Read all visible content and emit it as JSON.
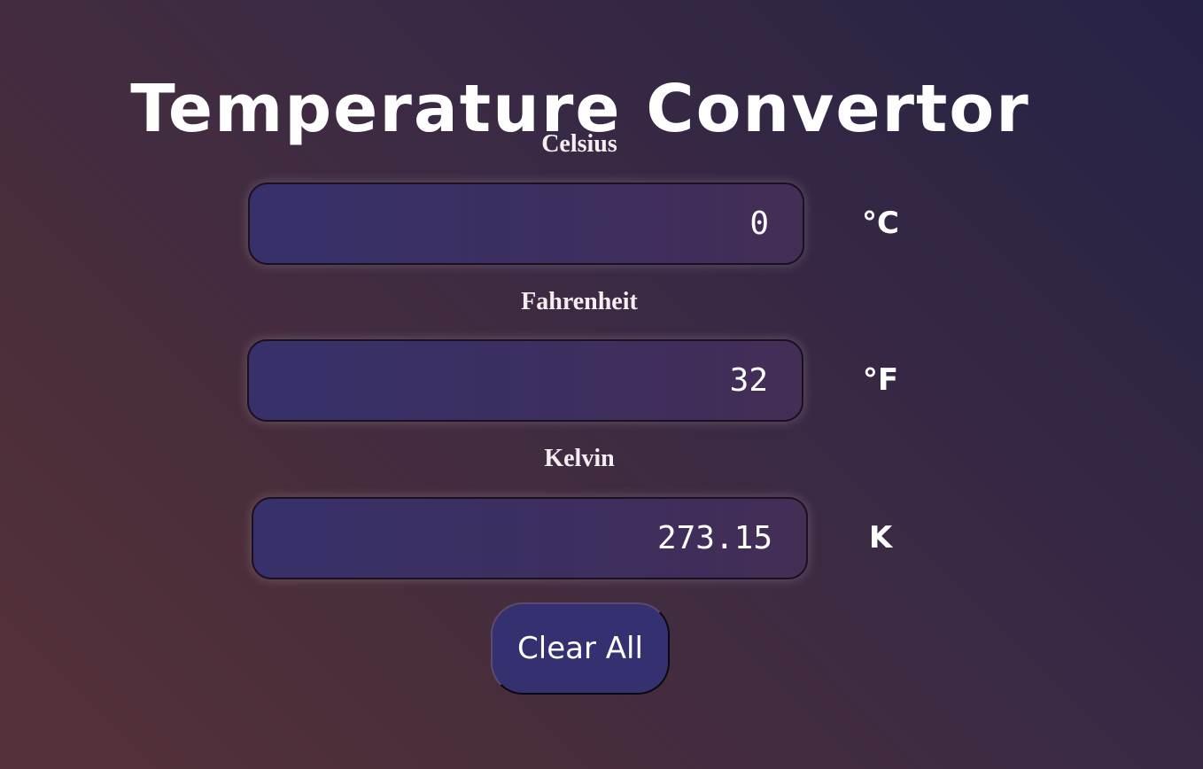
{
  "title": "Temperature Convertor",
  "fields": {
    "celsius": {
      "label": "Celsius",
      "value": "0",
      "unit": "°C"
    },
    "fahrenheit": {
      "label": "Fahrenheit",
      "value": "32",
      "unit": "°F"
    },
    "kelvin": {
      "label": "Kelvin",
      "value": "273.15",
      "unit": "K"
    }
  },
  "clear_button": {
    "label": "Clear All"
  },
  "colors": {
    "background_start": "#262245",
    "background_end": "#55323a",
    "input_fill": "#37306a",
    "button_fill": "#353070",
    "text": "#ffffff"
  }
}
